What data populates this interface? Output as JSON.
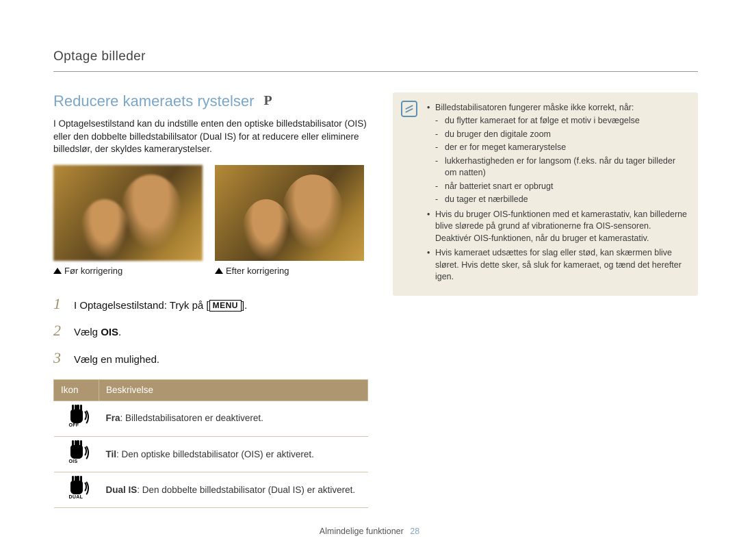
{
  "breadcrumb": "Optage billeder",
  "heading": "Reducere kameraets rystelser",
  "mode_indicator": "P",
  "intro": "I Optagelsestilstand kan du indstille enten den optiske billedstabilisator (OIS) eller den dobbelte billedstabililsator (Dual IS) for at reducere eller eliminere billedslør, der skyldes kamerarystelser.",
  "captions": {
    "before": "Før korrigering",
    "after": "Efter korrigering"
  },
  "steps": [
    {
      "num": "1",
      "pre": "I Optagelsestilstand: Tryk på [",
      "btn": "MENU",
      "post": "]."
    },
    {
      "num": "2",
      "pre": "Vælg ",
      "bold": "OIS",
      "post": "."
    },
    {
      "num": "3",
      "pre": "Vælg en mulighed.",
      "bold": "",
      "post": ""
    }
  ],
  "table": {
    "headers": {
      "icon": "Ikon",
      "desc": "Beskrivelse"
    },
    "rows": [
      {
        "sub": "OFF",
        "label": "Fra",
        "text": ": Billedstabilisatoren er deaktiveret."
      },
      {
        "sub": "OIS",
        "label": "Til",
        "text": ": Den optiske billedstabilisator (OIS) er aktiveret."
      },
      {
        "sub": "DUAL",
        "label": "Dual IS",
        "text": ": Den dobbelte billedstabilisator (Dual IS) er aktiveret."
      }
    ]
  },
  "notes": {
    "main": [
      "Billedstabilisatoren fungerer måske ikke korrekt, når:",
      "Hvis du bruger OIS-funktionen med et kamerastativ, kan billederne blive slørede på grund af vibrationerne fra OIS-sensoren. Deaktivér OIS-funktionen, når du bruger et kamerastativ.",
      "Hvis kameraet udsættes for slag eller stød, kan skærmen blive sløret. Hvis dette sker, så sluk for kameraet, og tænd det herefter igen."
    ],
    "sub": [
      "du flytter kameraet for at følge et motiv i bevægelse",
      "du bruger den digitale zoom",
      "der er for meget kamerarystelse",
      "lukkerhastigheden er for langsom (f.eks. når du tager billeder om natten)",
      "når batteriet snart er opbrugt",
      "du tager et nærbillede"
    ]
  },
  "footer": {
    "section": "Almindelige funktioner",
    "page": "28"
  }
}
